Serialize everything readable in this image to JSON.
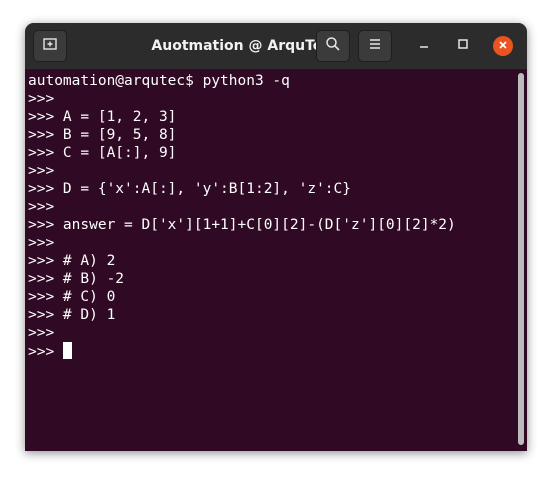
{
  "window": {
    "title": "Auotmation @ ArquTec"
  },
  "titlebar": {
    "new_tab_icon": "new-tab-icon",
    "search_icon": "search-icon",
    "menu_icon": "hamburger-menu-icon",
    "minimize_icon": "minimize-icon",
    "maximize_icon": "maximize-icon",
    "close_icon": "close-icon",
    "close_color": "#e95420"
  },
  "terminal": {
    "background": "#300a24",
    "lines": [
      "automation@arqutec$ python3 -q",
      ">>>",
      ">>> A = [1, 2, 3]",
      ">>> B = [9, 5, 8]",
      ">>> C = [A[:], 9]",
      ">>>",
      ">>> D = {'x':A[:], 'y':B[1:2], 'z':C}",
      ">>>",
      ">>> answer = D['x'][1+1]+C[0][2]-(D['z'][0][2]*2)",
      ">>>",
      ">>> # A) 2",
      ">>> # B) -2",
      ">>> # C) 0",
      ">>> # D) 1",
      ">>>"
    ],
    "prompt": ">>> "
  }
}
